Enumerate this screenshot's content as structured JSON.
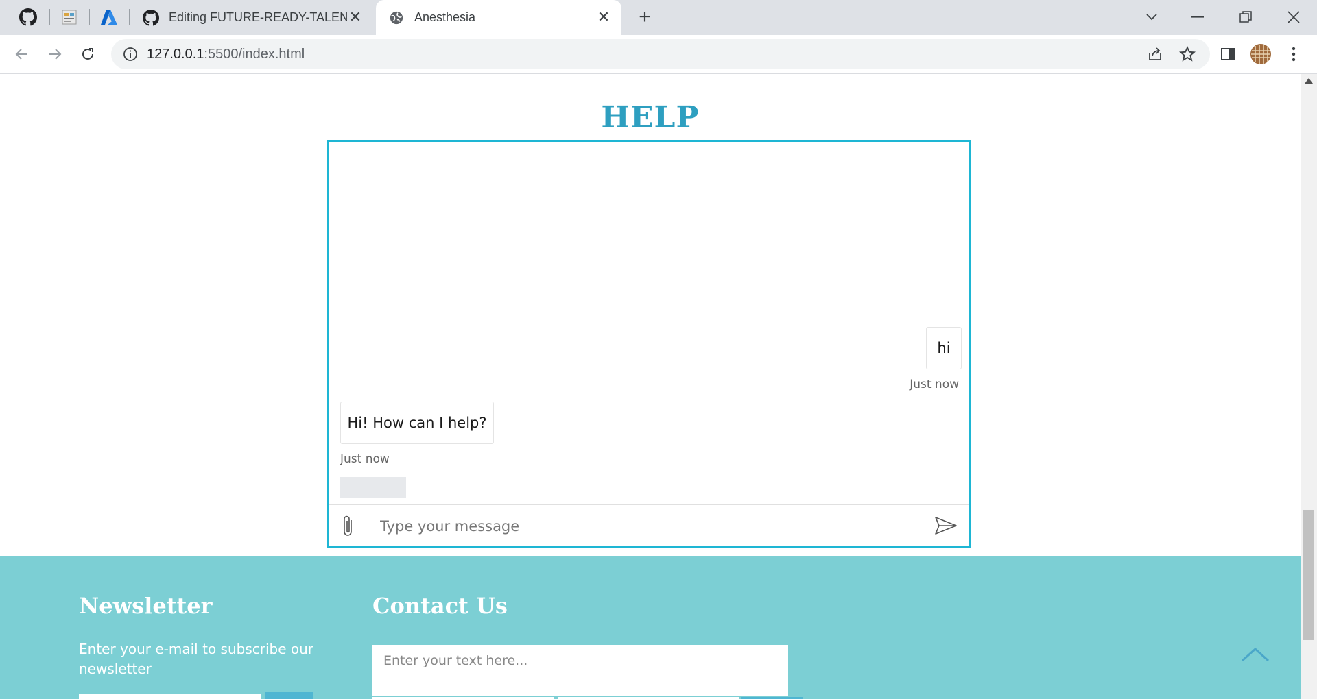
{
  "browser": {
    "tabs": [
      {
        "title": "Editing FUTURE-READY-TALENT-Pr",
        "favicon": "github-icon"
      },
      {
        "title": "Anesthesia",
        "favicon": "globe-icon",
        "active": true
      }
    ],
    "url_host": "127.0.0.1",
    "url_path": ":5500/index.html"
  },
  "page": {
    "help_title": "HELP",
    "chat": {
      "messages": [
        {
          "from": "user",
          "text": "hi",
          "time": "Just now"
        },
        {
          "from": "bot",
          "text": "Hi! How can I help?",
          "time": "Just now"
        }
      ],
      "input_placeholder": "Type your message"
    },
    "footer": {
      "newsletter_title": "Newsletter",
      "newsletter_text": "Enter your e-mail to subscribe our newsletter",
      "contact_title": "Contact Us",
      "contact_placeholder": "Enter your text here..."
    }
  },
  "colors": {
    "accent": "#2e9fc0",
    "chat_border": "#1eb6d4",
    "footer_bg": "#7ccfd4"
  }
}
